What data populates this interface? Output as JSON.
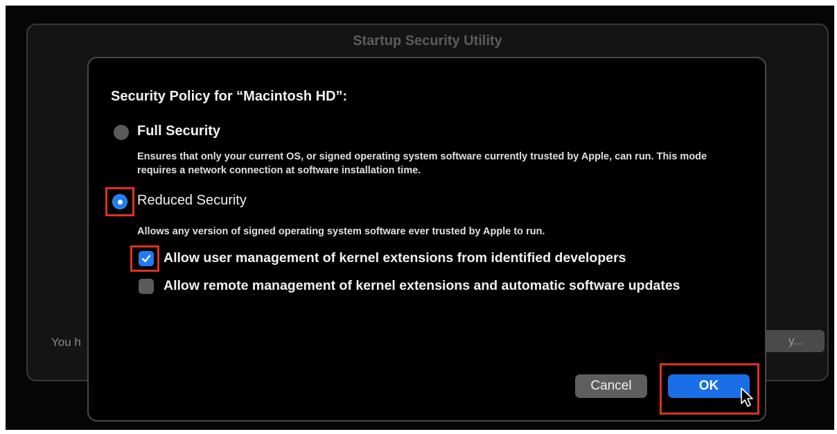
{
  "background_window": {
    "title": "Startup Security Utility",
    "partial_text": "You h",
    "partial_button": "y..."
  },
  "dialog": {
    "heading": "Security Policy for “Macintosh HD”:",
    "options": [
      {
        "label": "Full Security",
        "selected": false,
        "description": "Ensures that only your current OS, or signed operating system software currently trusted by Apple, can run. This mode requires a network connection at software installation time."
      },
      {
        "label": "Reduced Security",
        "selected": true,
        "description": "Allows any version of signed operating system software ever trusted by Apple to run."
      }
    ],
    "checkboxes": [
      {
        "label": "Allow user management of kernel extensions from identified developers",
        "checked": true
      },
      {
        "label": "Allow remote management of kernel extensions and automatic software updates",
        "checked": false
      }
    ],
    "buttons": {
      "cancel": "Cancel",
      "ok": "OK"
    }
  },
  "colors": {
    "accent": "#1f7cf2",
    "highlight": "#e0321f",
    "background": "#050505"
  }
}
